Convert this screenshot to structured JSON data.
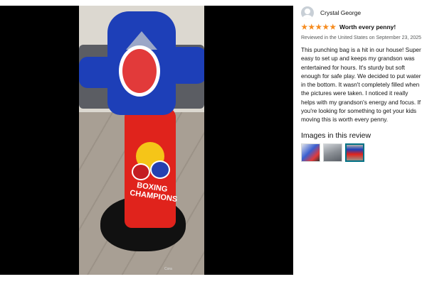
{
  "photo": {
    "bag_text": "BOXING CHAMPIONS",
    "credit": "Cora"
  },
  "review": {
    "reviewer_name": "Crystal George",
    "rating": 5,
    "rating_max": 5,
    "star_color": "#f68b1e",
    "title": "Worth every penny!",
    "meta": "Reviewed in the United States on September 23, 2025",
    "body": "This punching bag is a hit in our house! Super easy to set up and keeps my grandson was entertained for hours. It's sturdy but soft enough for safe play. We decided to put water in the bottom. It wasn't completely filled when the pictures were taken. I noticed it really helps with my grandson's energy and focus. If you're looking for something to get your kids moving this is worth every penny.",
    "images_heading": "Images in this review",
    "thumbnails": [
      "thumbnail-1",
      "thumbnail-2",
      "thumbnail-3"
    ],
    "selected_thumbnail": 3,
    "selected_border_color": "#007185"
  }
}
